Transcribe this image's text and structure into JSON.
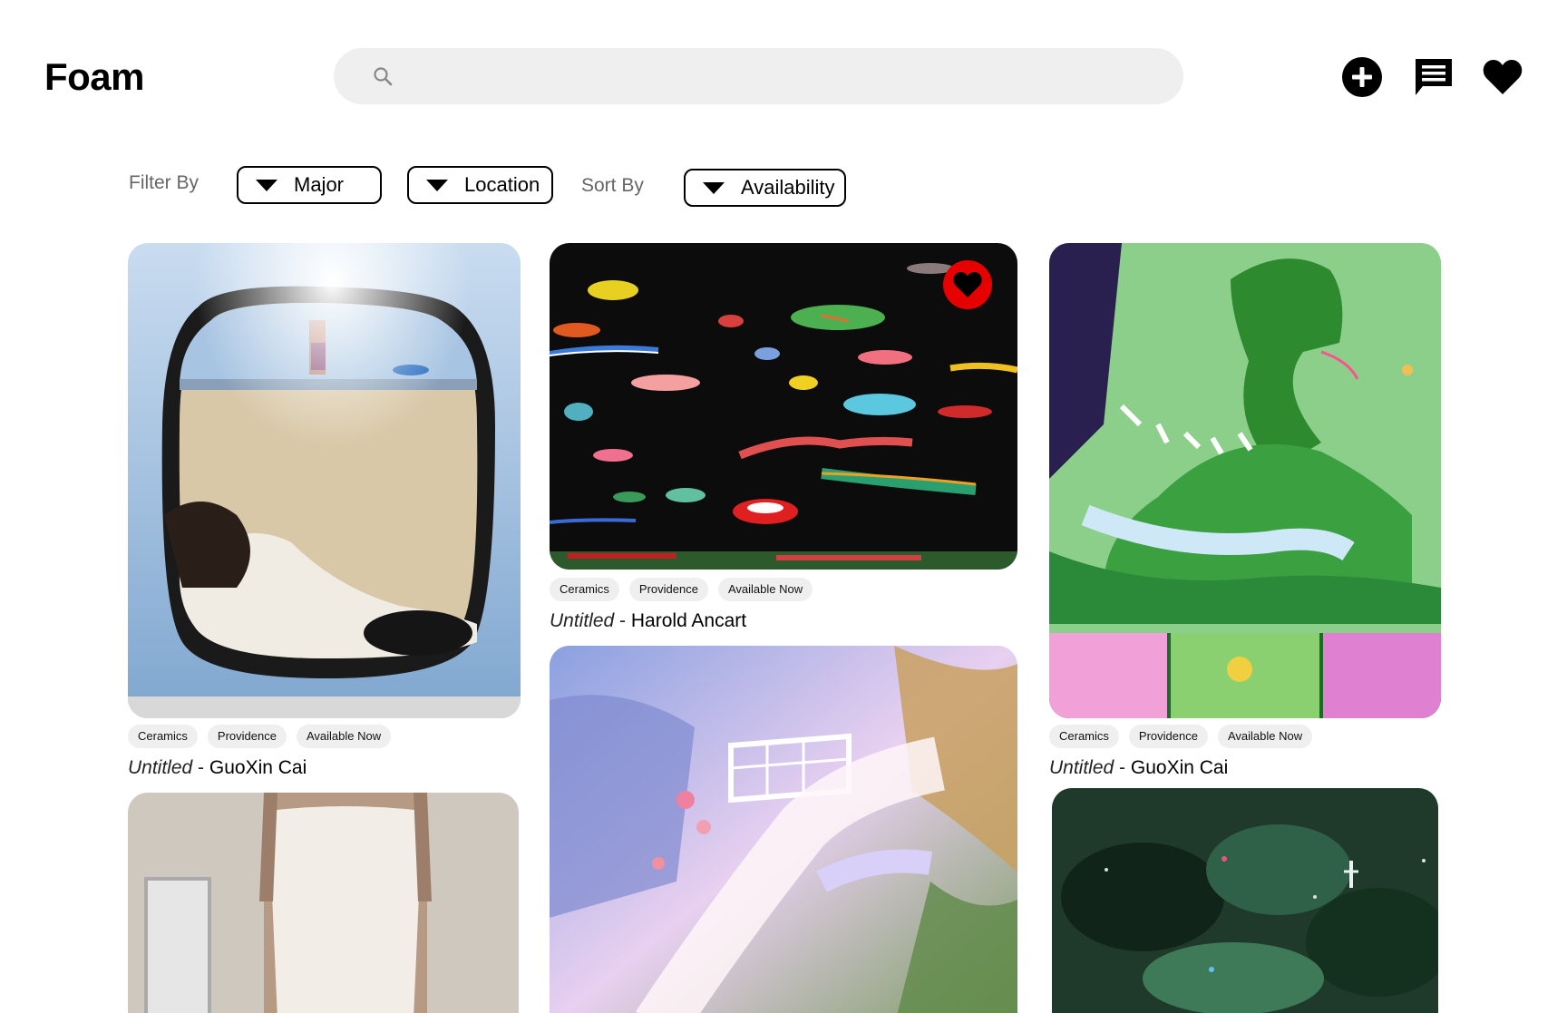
{
  "header": {
    "logo": "Foam",
    "search_placeholder": "",
    "icons": [
      "add-icon",
      "message-icon",
      "heart-icon"
    ]
  },
  "filters": {
    "filter_label": "Filter By",
    "major_label": "Major",
    "location_label": "Location",
    "sort_label": "Sort By",
    "availability_label": "Availability"
  },
  "cards": [
    {
      "tags": [
        "Ceramics",
        "Providence",
        "Available Now"
      ],
      "work": "Untitled",
      "sep": "-",
      "artist": "GuoXin Cai",
      "favorited": false
    },
    {
      "tags": [
        "Ceramics",
        "Providence",
        "Available Now"
      ],
      "work": "Untitled",
      "sep": "-",
      "artist": "Harold Ancart",
      "favorited": true
    },
    {
      "tags": [
        "Ceramics",
        "Providence",
        "Available Now"
      ],
      "work": "Untitled",
      "sep": "-",
      "artist": "GuoXin Cai",
      "favorited": false
    }
  ],
  "colors": {
    "favorite": "#e60000",
    "search_bg": "#efefef",
    "tag_bg": "#efefef"
  }
}
